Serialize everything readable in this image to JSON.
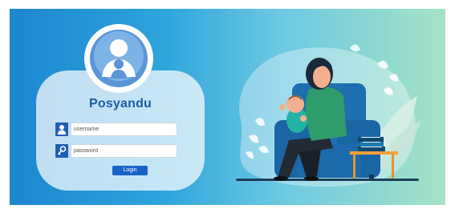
{
  "app": {
    "title": "Posyandu"
  },
  "form": {
    "username_placeholder": "username",
    "password_placeholder": "password",
    "login_label": "Login"
  },
  "icons": {
    "logo": "mother-and-child-logo-icon",
    "user": "user-icon",
    "password": "key-icon"
  },
  "colors": {
    "brand": "#1c5aa6",
    "button": "#1a62c8",
    "icon_bg": "#1e5fb5",
    "background_start": "#1d86cf",
    "background_end": "#a6e3c6"
  }
}
